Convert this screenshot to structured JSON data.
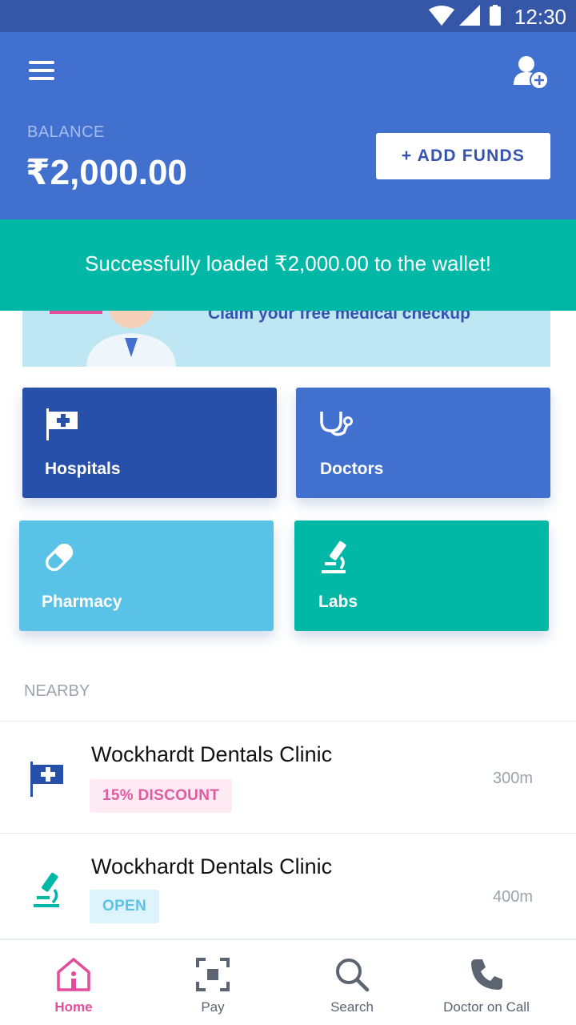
{
  "statusbar": {
    "time": "12:30"
  },
  "header": {
    "balance_label": "BALANCE",
    "balance_value": "₹2,000.00",
    "add_funds_label": "+ ADD FUNDS"
  },
  "banner": {
    "text": "Claim your free medical checkup"
  },
  "toast": {
    "message": "Successfully loaded ₹2,000.00 to the wallet!"
  },
  "categories": [
    {
      "label": "Hospitals",
      "icon": "hospital-flag-icon",
      "color": "#2650aa"
    },
    {
      "label": "Doctors",
      "icon": "stethoscope-icon",
      "color": "#4270cf"
    },
    {
      "label": "Pharmacy",
      "icon": "pill-icon",
      "color": "#5ac2e6"
    },
    {
      "label": "Labs",
      "icon": "microscope-icon",
      "color": "#00b8a5"
    }
  ],
  "nearby": {
    "title": "NEARBY",
    "items": [
      {
        "name": "Wockhardt Dentals Clinic",
        "badge": "15% DISCOUNT",
        "distance": "300m",
        "icon": "hospital-flag-icon"
      },
      {
        "name": "Wockhardt Dentals Clinic",
        "badge": "OPEN",
        "distance": "400m",
        "icon": "microscope-icon"
      }
    ]
  },
  "bottom_nav": [
    {
      "label": "Home",
      "icon": "home-icon",
      "active": true
    },
    {
      "label": "Pay",
      "icon": "scan-icon",
      "active": false
    },
    {
      "label": "Search",
      "icon": "search-icon",
      "active": false
    },
    {
      "label": "Doctor on Call",
      "icon": "phone-icon",
      "active": false
    }
  ],
  "colors": {
    "primary": "#4270cf",
    "primary_dark": "#2650aa",
    "teal": "#00b8a5",
    "sky": "#5ac2e6",
    "accent_pink": "#e34c9a"
  }
}
